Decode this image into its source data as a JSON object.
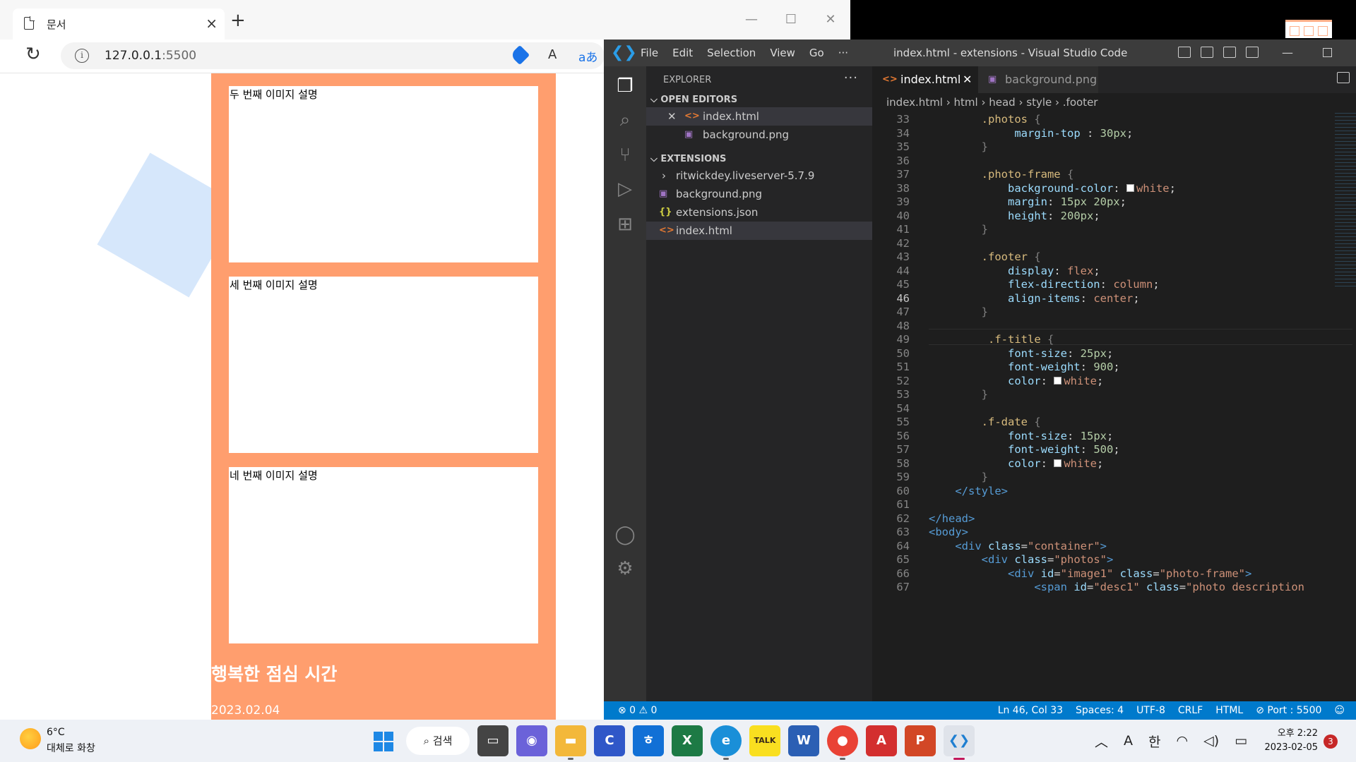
{
  "browser": {
    "tab_title": "문서",
    "url_host": "127.0.0.1",
    "url_port": ":5500",
    "read_aloud": "A",
    "translate": "aあ"
  },
  "page": {
    "frames": [
      {
        "desc": "두 번째 이미지 설명"
      },
      {
        "desc": "세 번째 이미지 설명"
      },
      {
        "desc": "네 번째 이미지 설명"
      }
    ],
    "footer_title": "행복한 점심 시간",
    "footer_date": "2023.02.04"
  },
  "vscode": {
    "menu": [
      "File",
      "Edit",
      "Selection",
      "View",
      "Go",
      "···"
    ],
    "window_title": "index.html - extensions - Visual Studio Code",
    "explorer_title": "EXPLORER",
    "open_editors_label": "OPEN EDITORS",
    "open_editors": [
      "index.html",
      "background.png"
    ],
    "extensions_label": "EXTENSIONS",
    "extensions_items": [
      "ritwickdey.liveserver-5.7.9",
      "background.png",
      "extensions.json",
      "index.html"
    ],
    "tabs": [
      "index.html",
      "background.png"
    ],
    "breadcrumb": [
      "index.html",
      "html",
      "head",
      "style",
      ".footer"
    ],
    "line_numbers": [
      "33",
      "34",
      "35",
      "36",
      "37",
      "38",
      "39",
      "40",
      "41",
      "42",
      "43",
      "44",
      "45",
      "46",
      "47",
      "48",
      "49",
      "50",
      "51",
      "52",
      "53",
      "54",
      "55",
      "56",
      "57",
      "58",
      "59",
      "60",
      "61",
      "62",
      "63",
      "64",
      "65",
      "66",
      "67"
    ],
    "current_line": "46",
    "status": {
      "problems": "⊗ 0 ⚠ 0",
      "position": "Ln 46, Col 33",
      "spaces": "Spaces: 4",
      "encoding": "UTF-8",
      "eol": "CRLF",
      "language": "HTML",
      "port": "⊘ Port : 5500"
    }
  },
  "taskbar": {
    "temperature": "6°C",
    "weather": "대체로 화창",
    "search_label": "검색",
    "tray_font": "A",
    "tray_ime": "한",
    "time": "오후 2:22",
    "date": "2023-02-05",
    "notification_count": "3"
  },
  "colors": {
    "page_bg": "#ff9e6e",
    "vscode_status": "#007acc",
    "vscode_bg": "#1e1e1e"
  }
}
